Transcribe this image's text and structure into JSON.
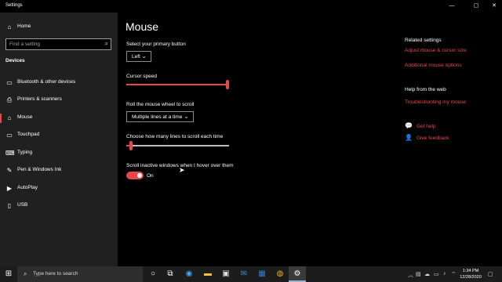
{
  "window": {
    "title": "Settings",
    "minimize_glyph": "—",
    "maximize_glyph": "▢",
    "close_glyph": "✕"
  },
  "sidebar": {
    "home_label": "Home",
    "search_placeholder": "Find a setting",
    "section_title": "Devices",
    "items": [
      {
        "label": "Bluetooth & other devices",
        "icon": "bluetooth-icon"
      },
      {
        "label": "Printers & scanners",
        "icon": "printer-icon"
      },
      {
        "label": "Mouse",
        "icon": "mouse-icon",
        "active": true
      },
      {
        "label": "Touchpad",
        "icon": "touchpad-icon"
      },
      {
        "label": "Typing",
        "icon": "keyboard-icon"
      },
      {
        "label": "Pen & Windows Ink",
        "icon": "pen-icon"
      },
      {
        "label": "AutoPlay",
        "icon": "autoplay-icon"
      },
      {
        "label": "USB",
        "icon": "usb-icon"
      }
    ]
  },
  "main": {
    "title": "Mouse",
    "primary_button": {
      "label": "Select your primary button",
      "value": "Left"
    },
    "cursor_speed": {
      "label": "Cursor speed",
      "level": 1.0
    },
    "scroll_wheel": {
      "label": "Roll the mouse wheel to scroll",
      "value": "Multiple lines at a time"
    },
    "lines_to_scroll": {
      "label": "Choose how many lines to scroll each time",
      "level": 0.03
    },
    "inactive_scroll": {
      "label": "Scroll inactive windows when I hover over them",
      "state_label": "On",
      "on": true
    }
  },
  "related": {
    "heading": "Related settings",
    "links": [
      "Adjust mouse & cursor size",
      "Additional mouse options"
    ],
    "help_heading": "Help from the web",
    "help_links": [
      "Troubleshooting my mouse"
    ],
    "get_help": "Get help",
    "give_feedback": "Give feedback"
  },
  "taskbar": {
    "search_placeholder": "Type here to search",
    "time": "1:34 PM",
    "date": "12/28/2020"
  },
  "colors": {
    "accent": "#e8474a",
    "sidebar_bg": "#202020",
    "main_bg": "#000000",
    "taskbar_bg": "#1c1c1c"
  }
}
